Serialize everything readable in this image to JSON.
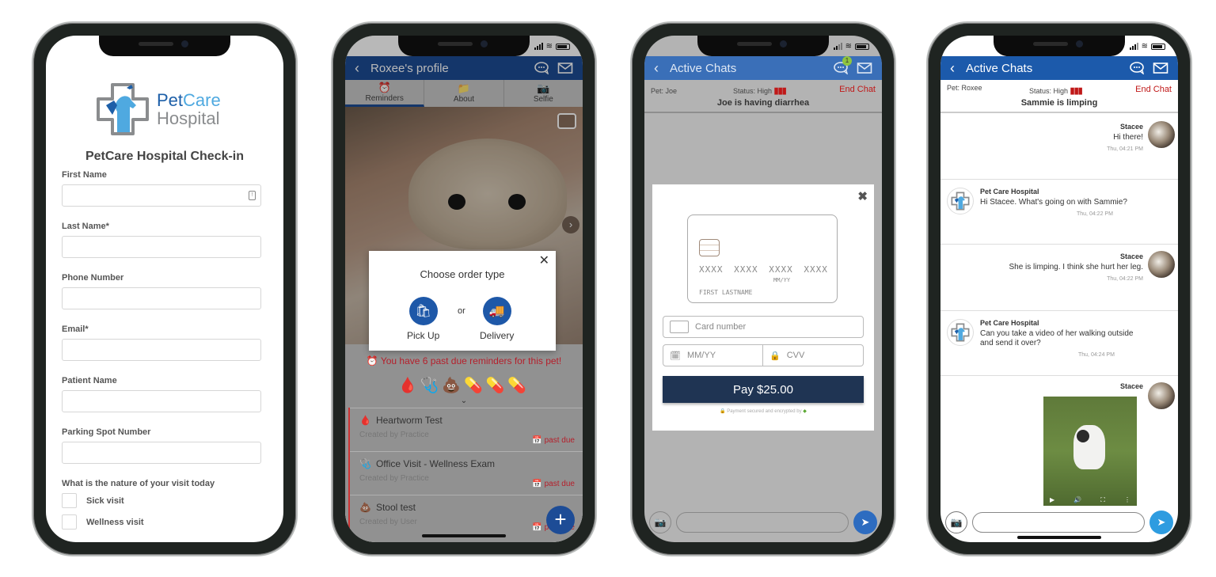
{
  "phones": {
    "checkin": {
      "logo": {
        "word1": "Pet",
        "word2": "Care",
        "word3": "Hospital"
      },
      "title": "PetCare Hospital Check-in",
      "fields": [
        {
          "label": "First Name",
          "value": ""
        },
        {
          "label": "Last Name*",
          "value": ""
        },
        {
          "label": "Phone Number",
          "value": ""
        },
        {
          "label": "Email*",
          "value": ""
        },
        {
          "label": "Patient Name",
          "value": ""
        },
        {
          "label": "Parking Spot Number",
          "value": ""
        }
      ],
      "question": "What is the nature of your visit today",
      "options": [
        {
          "label": "Sick visit",
          "checked": false
        },
        {
          "label": "Wellness visit",
          "checked": false
        }
      ]
    },
    "profile": {
      "header_title": "Roxee's profile",
      "header_color": "#1c4b94",
      "tabs": [
        {
          "label": "Reminders",
          "icon": "alarm-clock-icon",
          "active": true
        },
        {
          "label": "About",
          "icon": "folder-icon",
          "active": false
        },
        {
          "label": "Selfie",
          "icon": "camera-icon",
          "active": false
        }
      ],
      "modal": {
        "title": "Choose order type",
        "option1": "Pick Up",
        "separator": "or",
        "option2": "Delivery"
      },
      "past_due_banner": "You have 6 past due reminders for this pet!",
      "reminder_icons": [
        "🩸",
        "🩺",
        "💩",
        "💊",
        "💊",
        "💊"
      ],
      "reminders": [
        {
          "icon": "🩸",
          "title": "Heartworm Test",
          "created_by": "Created by Practice",
          "status": "past due"
        },
        {
          "icon": "🩺",
          "title": "Office Visit - Wellness Exam",
          "created_by": "Created by Practice",
          "status": "past due"
        },
        {
          "icon": "💩",
          "title": "Stool test",
          "created_by": "Created by User",
          "status": "past due"
        }
      ],
      "fab": "+"
    },
    "payment": {
      "header_title": "Active Chats",
      "header_color": "#3a6fb8",
      "unread_badge": "1",
      "pet": "Pet: Joe",
      "status_label": "Status: High",
      "end_chat": "End Chat",
      "subject": "Joe is having diarrhea",
      "card": {
        "number": "XXXX XXXX XXXX XXXX",
        "expiry": "MM/YY",
        "name": "FIRST LASTNAME"
      },
      "card_number_placeholder": "Card number",
      "expiry_placeholder": "MM/YY",
      "cvv_placeholder": "CVV",
      "pay_button": "Pay $25.00",
      "secure_note": "Payment secured and encrypted by"
    },
    "chat": {
      "header_title": "Active Chats",
      "header_color": "#1c5aab",
      "pet": "Pet: Roxee",
      "status_label": "Status: High",
      "end_chat": "End Chat",
      "subject": "Sammie is limping",
      "messages": [
        {
          "from": "Stacee",
          "text": "Hi there!",
          "time": "Thu, 04:21 PM",
          "dir": "out"
        },
        {
          "from": "Pet Care Hospital",
          "text": "Hi Stacee. What's going on with Sammie?",
          "time": "Thu, 04:22 PM",
          "dir": "in"
        },
        {
          "from": "Stacee",
          "text": "She is limping. I think she hurt her leg.",
          "time": "Thu, 04:22 PM",
          "dir": "out"
        },
        {
          "from": "Pet Care Hospital",
          "text": "Can you take a video of her walking outside and send it over?",
          "time": "Thu, 04:24 PM",
          "dir": "in"
        },
        {
          "from": "Stacee",
          "text": "",
          "time": "",
          "dir": "out",
          "attachment": "video"
        }
      ]
    }
  }
}
